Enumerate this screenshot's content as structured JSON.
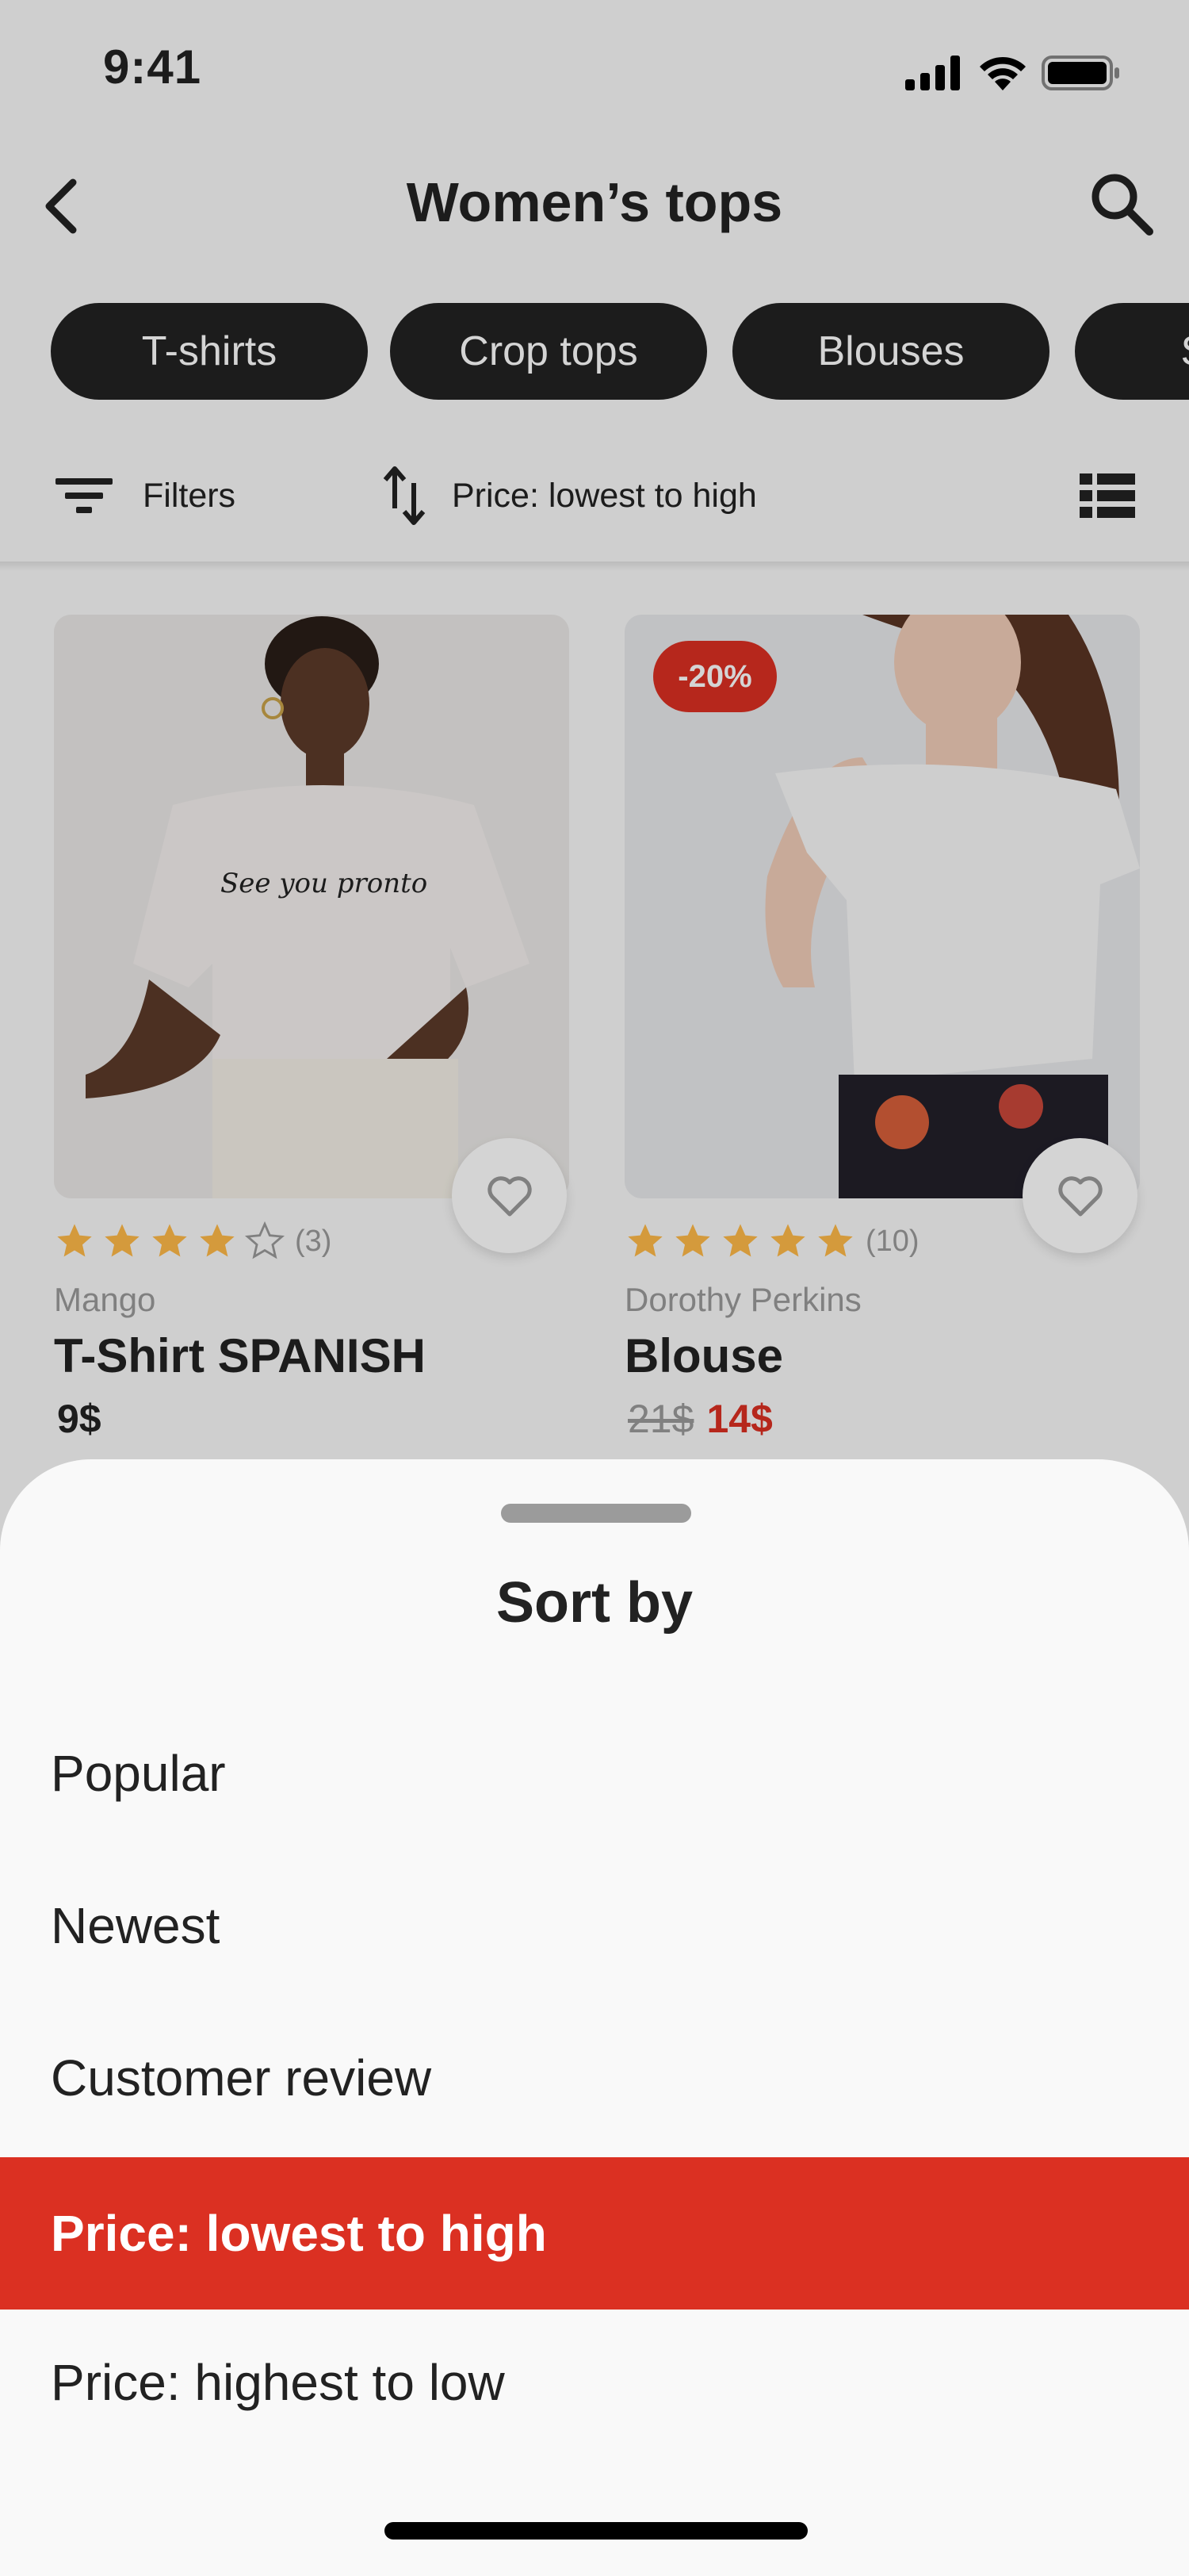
{
  "status_bar": {
    "time": "9:41"
  },
  "header": {
    "title": "Women’s tops"
  },
  "categories": [
    "T-shirts",
    "Crop tops",
    "Blouses",
    "Shirts"
  ],
  "filter_bar": {
    "filters_label": "Filters",
    "sort_label": "Price: lowest to high"
  },
  "products": [
    {
      "brand": "Mango",
      "name": "T-Shirt SPANISH",
      "price": "9$",
      "rating": 4,
      "rating_count": "(3)",
      "image_text": "See you pronto"
    },
    {
      "brand": "Dorothy Perkins",
      "name": "Blouse",
      "old_price": "21$",
      "price": "14$",
      "discount": "-20%",
      "rating": 5,
      "rating_count": "(10)"
    }
  ],
  "sort_sheet": {
    "title": "Sort by",
    "options": [
      "Popular",
      "Newest",
      "Customer review",
      "Price: lowest to high",
      "Price: highest to low"
    ],
    "selected": "Price: lowest to high"
  },
  "colors": {
    "accent": "#DB3022",
    "star": "#FFBA49",
    "dark": "#222222",
    "grey": "#9B9B9B"
  },
  "icons": [
    "back-icon",
    "search-icon",
    "filter-icon",
    "sort-icon",
    "list-view-icon",
    "heart-icon",
    "star-icon"
  ]
}
